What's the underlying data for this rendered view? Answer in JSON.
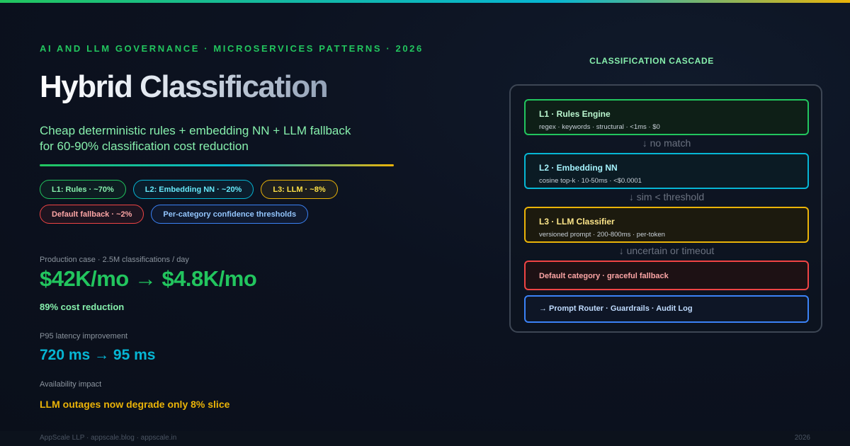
{
  "eyebrow": "AI AND LLM GOVERNANCE · MICROSERVICES PATTERNS · 2026",
  "title": "Hybrid Classification",
  "subtitle": "Cheap deterministic rules + embedding NN + LLM fallback for 60-90% classification cost reduction",
  "pills": [
    "L1: Rules · ~70%",
    "L2: Embedding NN · ~20%",
    "L3: LLM · ~8%",
    "Default fallback · ~2%",
    "Per-category confidence thresholds"
  ],
  "stats": {
    "case_label": "Production case · 2.5M classifications / day",
    "cost_value": "$42K/mo → $4.8K/mo",
    "cost_sub": "89% cost reduction",
    "latency_label": "P95 latency improvement",
    "latency_value": "720 ms → 95 ms",
    "availability_label": "Availability impact",
    "availability_value": "LLM outages now degrade only 8% slice"
  },
  "cascade": {
    "title": "CLASSIFICATION CASCADE",
    "l1_title": "L1 · Rules Engine",
    "l1_desc": "regex · keywords · structural · <1ms · $0",
    "arrow1": "↓ no match",
    "l2_title": "L2 · Embedding NN",
    "l2_desc": "cosine top-k · 10-50ms · <$0.0001",
    "arrow2": "↓ sim < threshold",
    "l3_title": "L3 · LLM Classifier",
    "l3_desc": "versioned prompt · 200-800ms · per-token",
    "arrow3": "↓ uncertain or timeout",
    "default_title": "Default category · graceful fallback",
    "router_title": "→ Prompt Router · Guardrails · Audit Log"
  },
  "footer": {
    "left": "AppScale LLP · appscale.blog · appscale.in",
    "right": "2026"
  },
  "colors": {
    "green": "#22c55e",
    "cyan": "#06b6d4",
    "yellow": "#eab308",
    "red": "#ef4444",
    "blue": "#3b82f6"
  }
}
